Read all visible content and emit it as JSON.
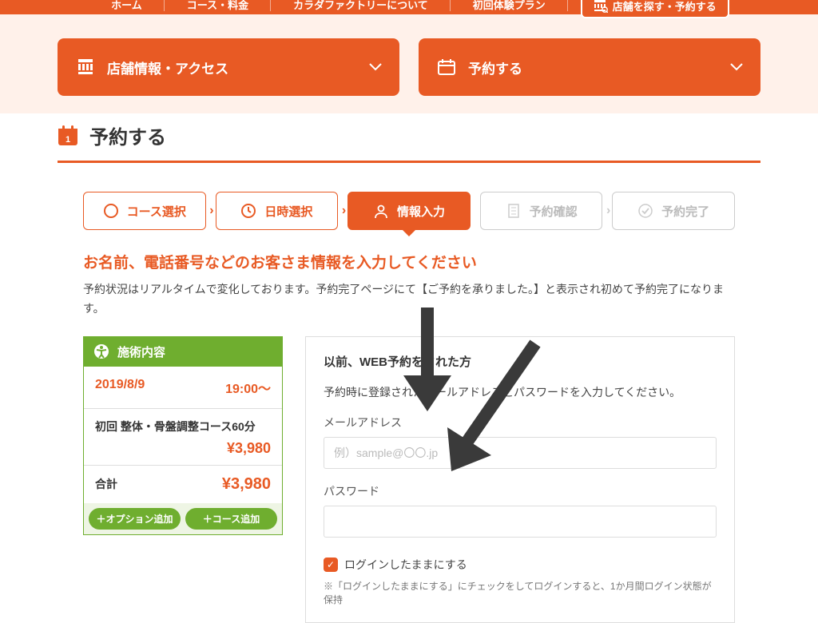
{
  "nav": {
    "home": "ホーム",
    "courses": "コース・料金",
    "about": "カラダファクトリーについて",
    "trial": "初回体験プラン",
    "find": "店舗を探す・予約する"
  },
  "bigButtons": {
    "access": "店舗情報・アクセス",
    "reserve": "予約する"
  },
  "pageTitle": "予約する",
  "steps": {
    "s1": "コース選択",
    "s2": "日時選択",
    "s3": "情報入力",
    "s4": "予約確認",
    "s5": "予約完了"
  },
  "subHeading": "お名前、電話番号などのお客さま情報を入力してください",
  "subDesc": "予約状況はリアルタイムで変化しております。予約完了ページにて【ご予約を承りました。】と表示され初めて予約完了になります。",
  "summary": {
    "head": "施術内容",
    "date": "2019/8/9",
    "time": "19:00〜",
    "course": "初回 整体・骨盤調整コース60分",
    "coursePrice": "¥3,980",
    "totalLabel": "合計",
    "totalPrice": "¥3,980",
    "btnOption": "＋オプション追加",
    "btnCourse": "＋コース追加"
  },
  "login": {
    "title": "以前、WEB予約をされた方",
    "desc": "予約時に登録されたメールアドレスとパスワードを入力してください。",
    "emailLabel": "メールアドレス",
    "emailPlaceholder": "例）sample@〇〇.jp",
    "passLabel": "パスワード",
    "stayLogged": "ログインしたままにする",
    "note": "※「ログインしたままにする」にチェックをしてログインすると、1か月間ログイン状態が保持"
  }
}
